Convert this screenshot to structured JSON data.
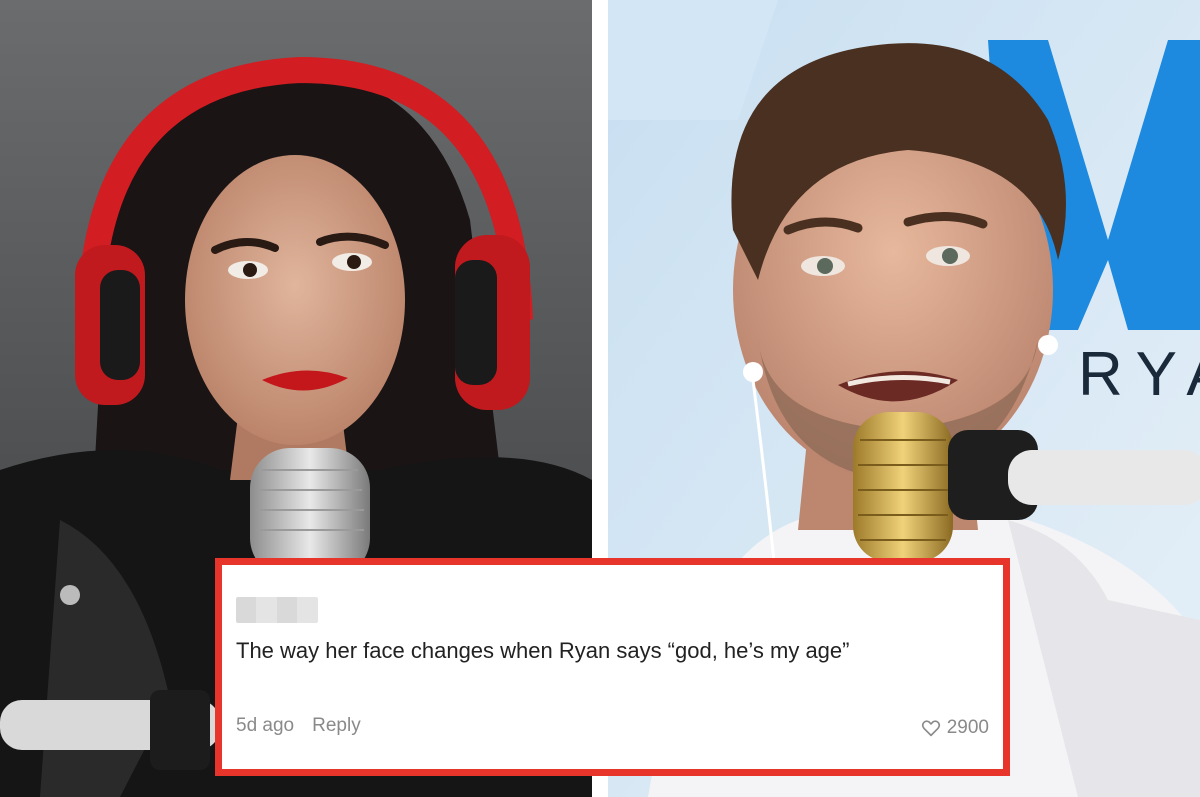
{
  "photos": {
    "left": {
      "subject": "woman-with-red-headphones-at-microphone"
    },
    "right": {
      "subject": "man-speaking-into-gold-microphone",
      "background_text": "RYA"
    }
  },
  "comment": {
    "username": "",
    "text": "The way her face changes when Ryan says “god, he’s my age”",
    "timestamp": "5d ago",
    "reply_label": "Reply",
    "likes": "2900",
    "like_icon": "heart-outline-icon"
  },
  "colors": {
    "card_border": "#e8352b",
    "meta_text": "#8a8a8a",
    "comment_text": "#222222"
  }
}
